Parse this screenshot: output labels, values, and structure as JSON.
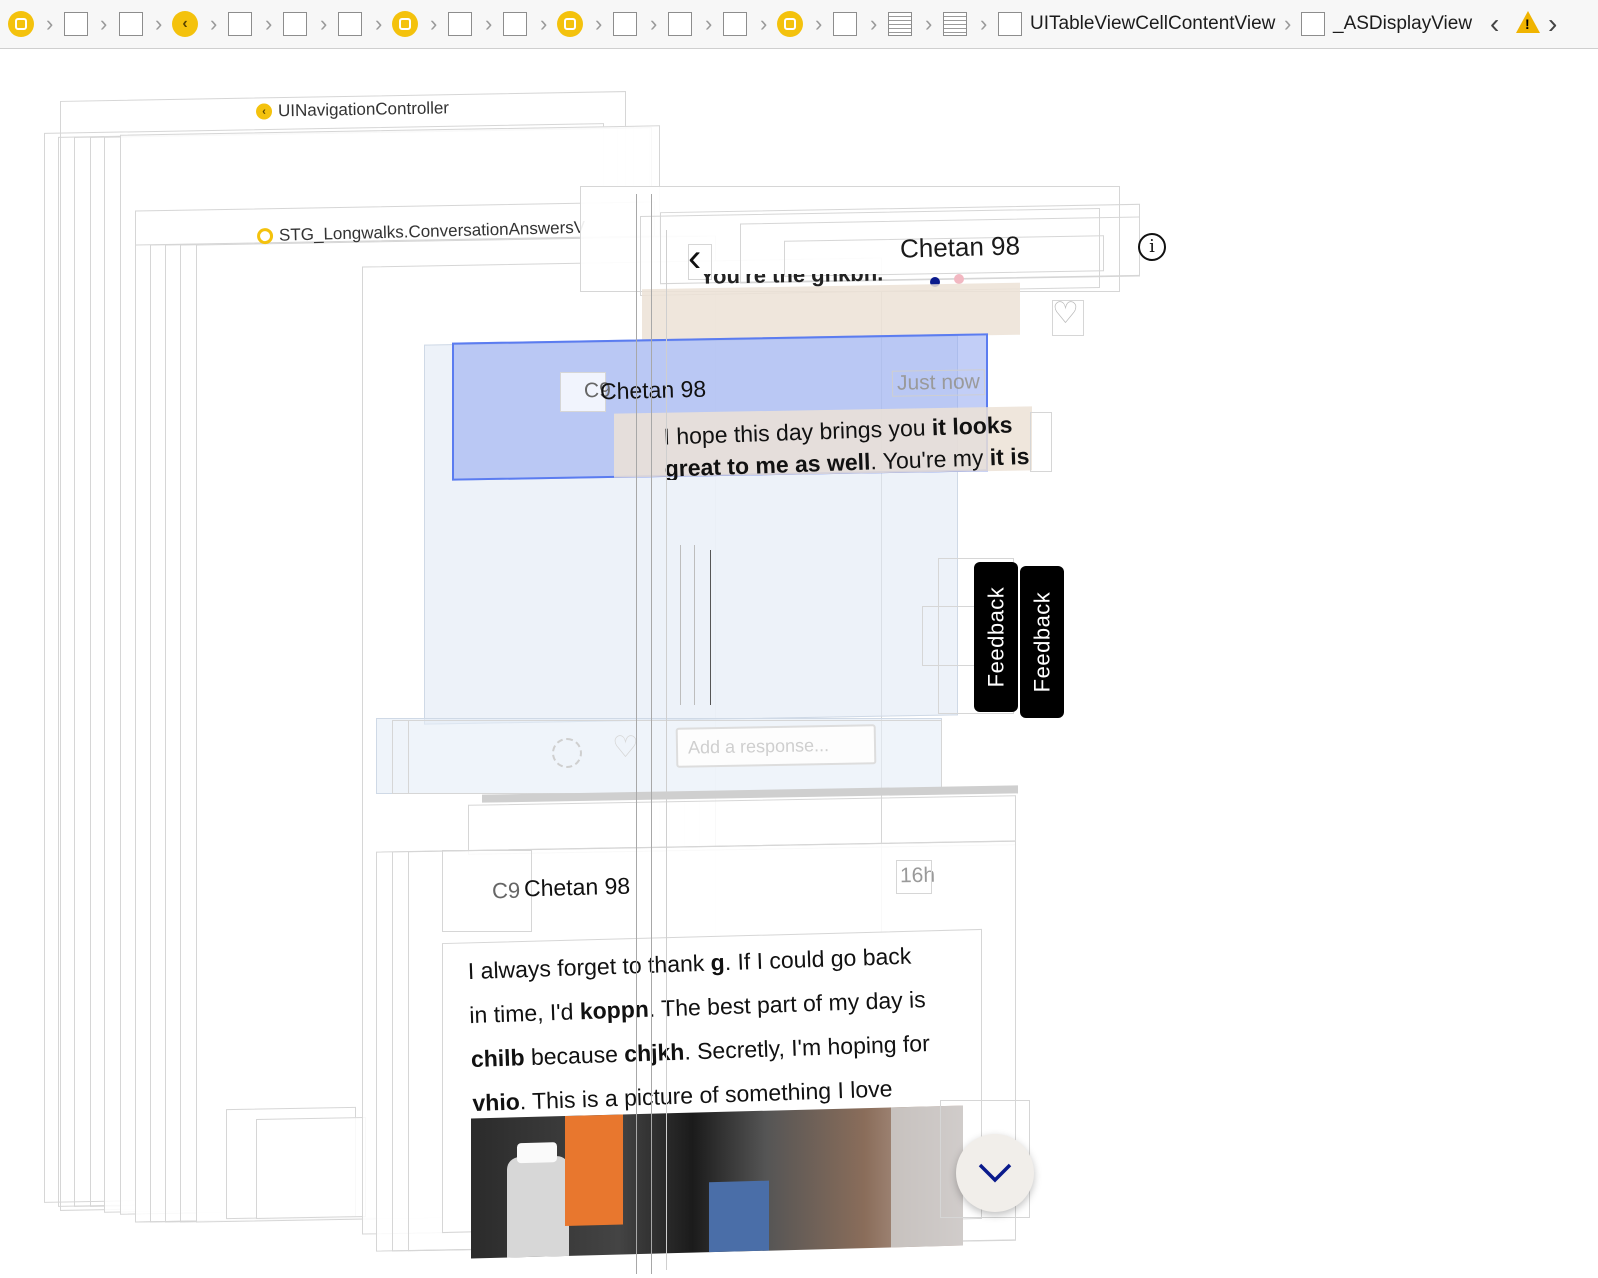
{
  "jumpbar": {
    "cell_content_label": "UITableViewCellContentView",
    "display_view_label": "_ASDisplayView"
  },
  "hierarchy": {
    "nav_controller_label": "UINavigationController",
    "view_controller_label": "STG_Longwalks.ConversationAnswersV"
  },
  "navbar": {
    "back_glyph": "‹",
    "title": "Chetan 98",
    "info_glyph": "i",
    "page_dots": [
      "#0a1a8c",
      "#f2b8c2"
    ]
  },
  "top_cell": {
    "clipped_text": "You're the ghkbh."
  },
  "selected_cell": {
    "initials": "C9",
    "author": "Chetan 98",
    "time": "Just now",
    "message": {
      "t1": "I hope this day brings you ",
      "b1": "it looks",
      "b2": "great to me as well",
      "t2": ". You're my ",
      "b3": "it is"
    }
  },
  "feedback_tabs": [
    "Feedback",
    "Feedback"
  ],
  "composer": {
    "placeholder": "Add a response..."
  },
  "second_cell": {
    "initials": "C9",
    "author": "Chetan 98",
    "time": "16h",
    "message": {
      "t1": "I always forget to thank ",
      "b1": "g",
      "t2": ". If I could go back",
      "t3": "in time, I'd ",
      "b2": "koppn",
      "t4": ". The best part of my day is",
      "b3": "chilb",
      "t5": " because ",
      "b4": "chjkh",
      "t6": ". Secretly, I'm hoping for",
      "b5": "vhio",
      "t7": ". This is a picture of something I love"
    }
  },
  "colors": {
    "accent_yellow": "#f4c20d",
    "selection_blue": "#8fa6f0",
    "chevron_blue": "#0a1a8c"
  }
}
